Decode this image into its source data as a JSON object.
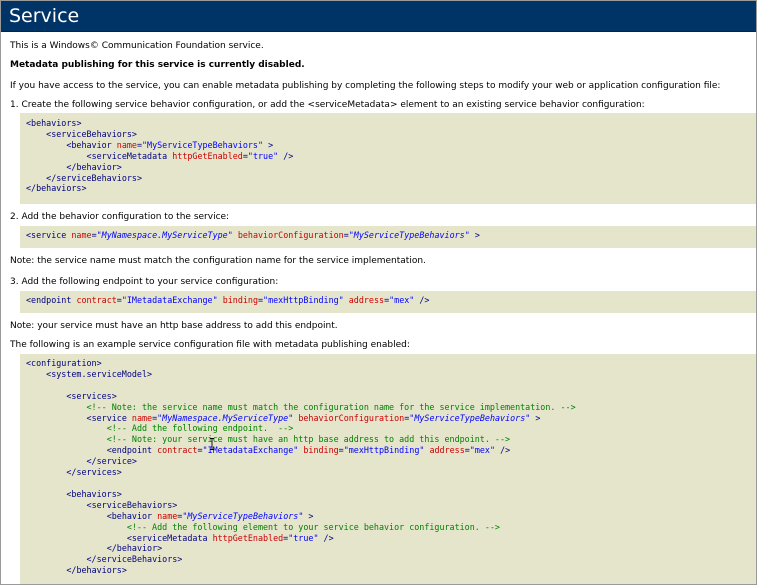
{
  "header": {
    "title": "Service"
  },
  "intro": "This is a Windows© Communication Foundation service.",
  "disabled_notice": "Metadata publishing for this service is currently disabled.",
  "instructions": "If you have access to the service, you can enable metadata publishing by completing the following steps to modify your web or application configuration file:",
  "step1": "1. Create the following service behavior configuration, or add the <serviceMetadata> element to an existing service behavior configuration:",
  "step2": "2. Add the behavior configuration to the service:",
  "note1": "Note: the service name must match the configuration name for the service implementation.",
  "step3": "3. Add the following endpoint to your service configuration:",
  "note2": "Note: your service must have an http base address to add this endpoint.",
  "example_intro": "The following is an example service configuration file with metadata publishing enabled:",
  "colors": {
    "header_bg": "#003366",
    "code_bg": "#e5e5cc",
    "tag": "#000080",
    "attr": "#cc0000",
    "value": "#0000ff",
    "comment": "#008000"
  },
  "xml": {
    "behaviors": "behaviors",
    "serviceBehaviors": "serviceBehaviors",
    "behavior": "behavior",
    "serviceMetadata": "serviceMetadata",
    "service": "service",
    "endpoint": "endpoint",
    "configuration": "configuration",
    "system_serviceModel": "system.serviceModel",
    "services": "services",
    "attr_name": "name",
    "attr_httpGetEnabled": "httpGetEnabled",
    "attr_behaviorConfiguration": "behaviorConfiguration",
    "attr_contract": "contract",
    "attr_binding": "binding",
    "attr_address": "address",
    "val_behaviorName": "MyServiceTypeBehaviors",
    "val_true": "true",
    "val_serviceName": "MyNamespace.MyServiceType",
    "val_contract": "IMetadataExchange",
    "val_binding": "mexHttpBinding",
    "val_address": "mex",
    "comment_name": "<!-- Note: the service name must match the configuration name for the service implementation. -->",
    "comment_add_endpoint": "<!-- Add the following endpoint.  -->",
    "comment_http_base": "<!-- Note: your service must have an http base address to add this endpoint. -->",
    "comment_add_element": "<!-- Add the following element to your service behavior configuration. -->"
  }
}
